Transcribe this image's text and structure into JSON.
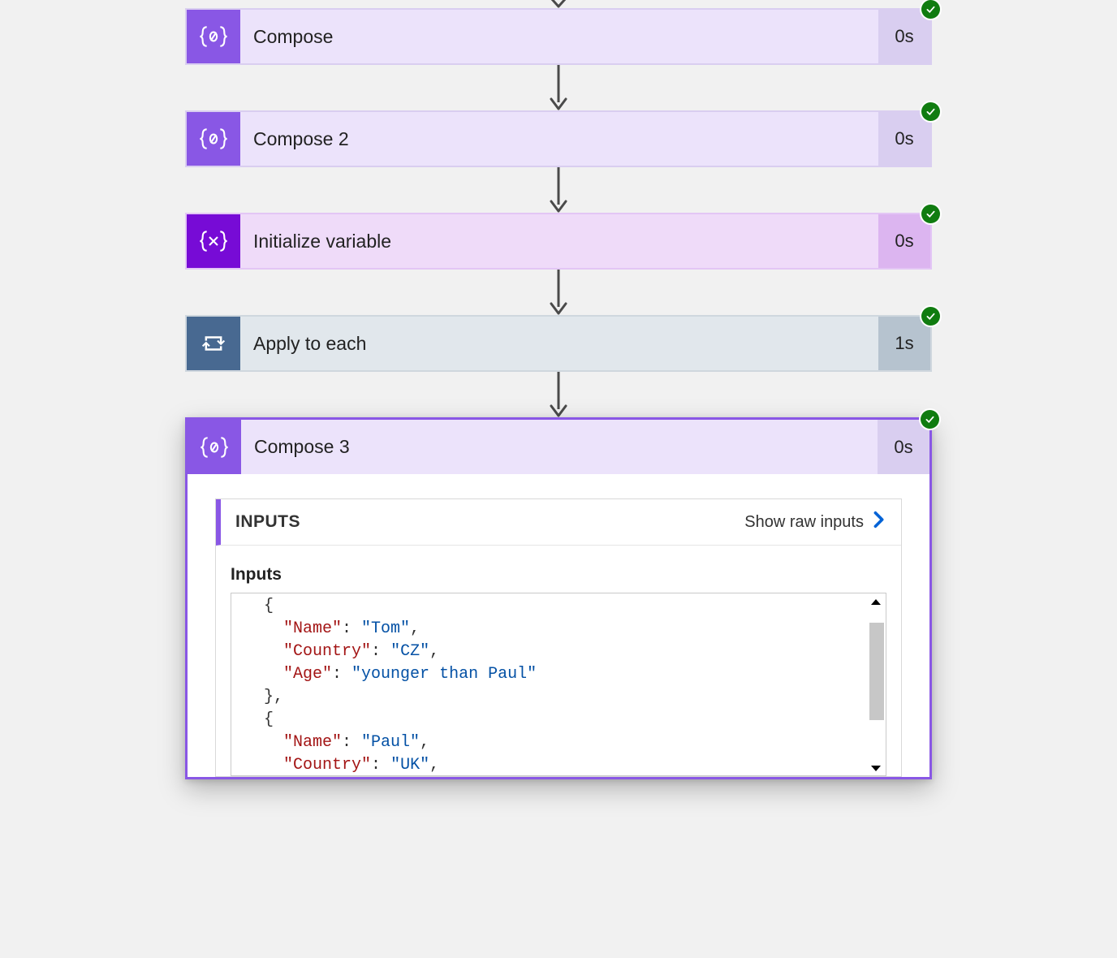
{
  "steps": [
    {
      "title": "Compose",
      "time": "0s",
      "kind": "compose"
    },
    {
      "title": "Compose 2",
      "time": "0s",
      "kind": "compose"
    },
    {
      "title": "Initialize variable",
      "time": "0s",
      "kind": "dataops"
    },
    {
      "title": "Apply to each",
      "time": "1s",
      "kind": "control"
    }
  ],
  "expanded": {
    "title": "Compose 3",
    "time": "0s",
    "inputs_header": "INPUTS",
    "show_raw_label": "Show raw inputs",
    "inputs_sublabel": "Inputs",
    "json": [
      {
        "Name": "Tom",
        "Country": "CZ",
        "Age": "younger than Paul"
      },
      {
        "Name": "Paul",
        "Country": "UK"
      }
    ]
  }
}
